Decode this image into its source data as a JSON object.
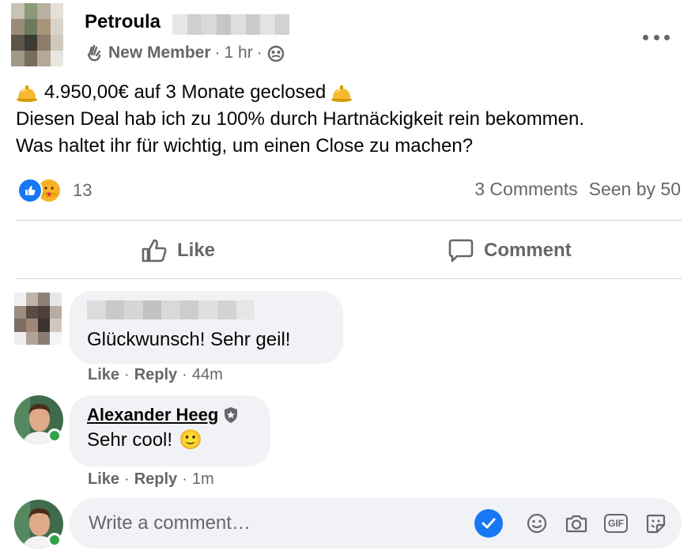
{
  "post": {
    "author": "Petroula",
    "badge": "New Member",
    "time": "1 hr",
    "separator": "·",
    "line1": "4.950,00€ auf 3 Monate geclosed",
    "line2": "Diesen Deal hab ich zu 100% durch Hartnäckigkeit rein bekommen.",
    "line3": "Was haltet ihr für wichtig, um einen Close zu machen?"
  },
  "reactions": {
    "count": "13",
    "types": [
      "like",
      "care"
    ],
    "comments_label": "3 Comments",
    "seen_label": "Seen by 50"
  },
  "actions": {
    "like_label": "Like",
    "comment_label": "Comment"
  },
  "comments": [
    {
      "text": "Glückwunsch! Sehr geil!",
      "like": "Like",
      "reply": "Reply",
      "time": "44m"
    },
    {
      "name": "Alexander Heeg",
      "text": "Sehr cool!",
      "emoji": "🙂",
      "like": "Like",
      "reply": "Reply",
      "time": "1m"
    }
  ],
  "composer": {
    "placeholder": "Write a comment…",
    "gif_label": "GIF"
  },
  "colors": {
    "accent": "#1877f2",
    "secondary_text": "#65676b",
    "bubble_bg": "#f0f2f5",
    "divider": "#ced0d4",
    "online": "#31a24c"
  },
  "icons": [
    "wave-icon",
    "group-members-icon",
    "more-options-icon",
    "bell-emoji-icon",
    "like-reaction-icon",
    "care-reaction-icon",
    "thumbs-up-icon",
    "comment-bubble-icon",
    "shield-badge-icon",
    "checkmark-icon",
    "emoji-icon",
    "camera-icon",
    "gif-icon",
    "sticker-icon"
  ]
}
